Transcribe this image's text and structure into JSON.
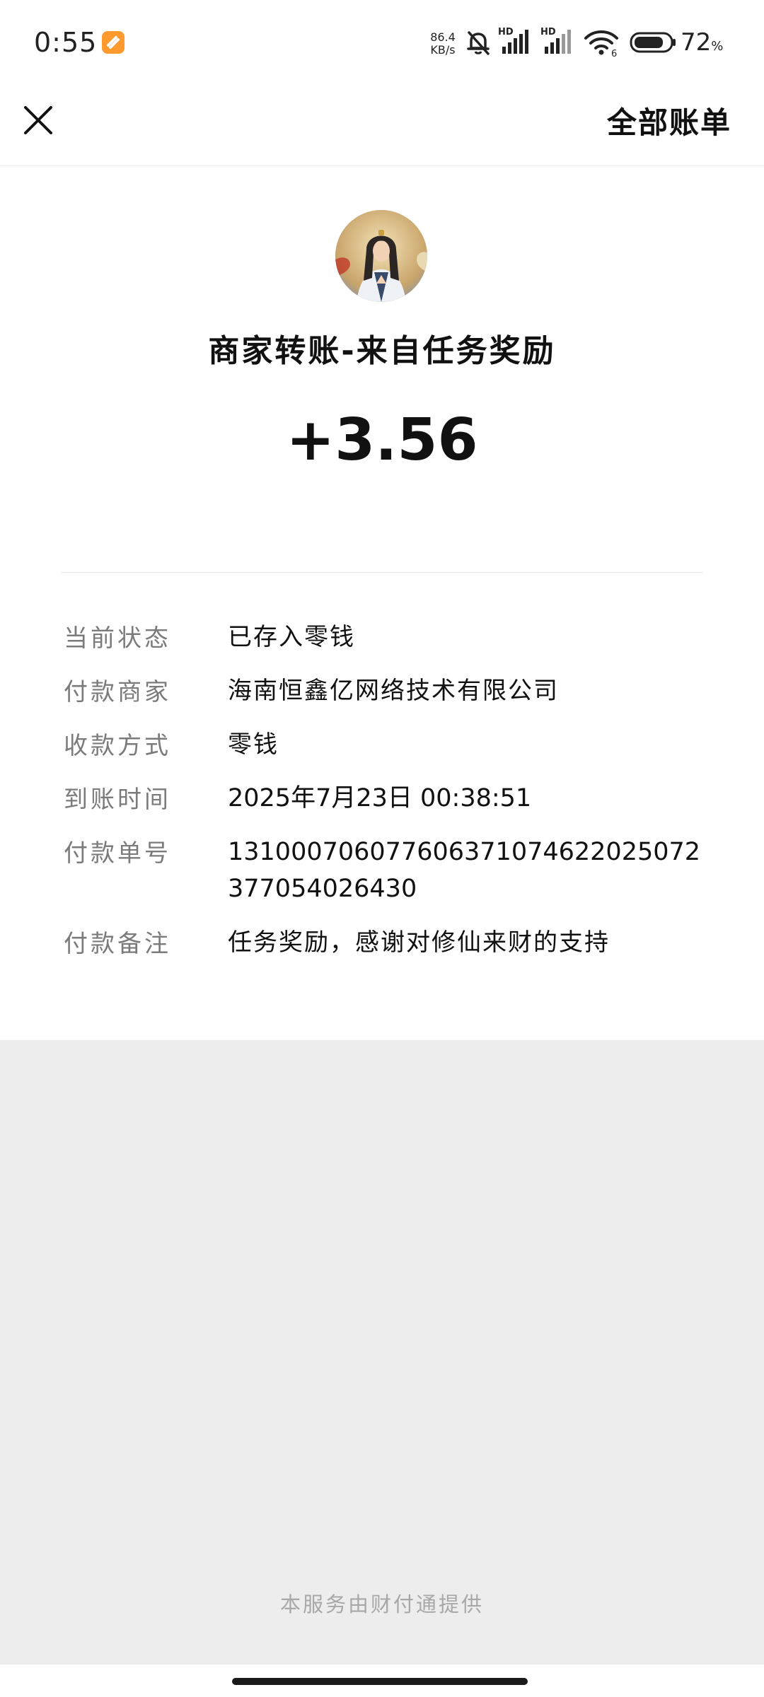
{
  "status_bar": {
    "time": "0:55",
    "speed_value": "86.4",
    "speed_unit": "KB/s",
    "battery_percent": "72",
    "battery_unit": "%",
    "icons": [
      "app-notification-icon",
      "mute-bell-icon",
      "hd-signal-icon",
      "hd-signal-icon",
      "wifi-6-icon",
      "battery-icon"
    ]
  },
  "nav": {
    "close_icon": "close-icon",
    "all_bills_label": "全部账单"
  },
  "transaction": {
    "title": "商家转账-来自任务奖励",
    "amount": "+3.56",
    "details": [
      {
        "label": "当前状态",
        "value": "已存入零钱"
      },
      {
        "label": "付款商家",
        "value": "海南恒鑫亿网络技术有限公司"
      },
      {
        "label": "收款方式",
        "value": "零钱"
      },
      {
        "label": "到账时间",
        "value": "2025年7月23日 00:38:51"
      },
      {
        "label": "付款单号",
        "value": "131000706077606371074622025072377054026430"
      },
      {
        "label": "付款备注",
        "value": "任务奖励，感谢对修仙来财的支持"
      }
    ]
  },
  "footer": {
    "provider_text": "本服务由财付通提供"
  },
  "colors": {
    "page_background": "#ededed",
    "card_background": "#ffffff",
    "label_gray": "#7b7b7b",
    "footer_gray": "#a8a8a8",
    "app_icon_orange": "#ff9a2e"
  }
}
